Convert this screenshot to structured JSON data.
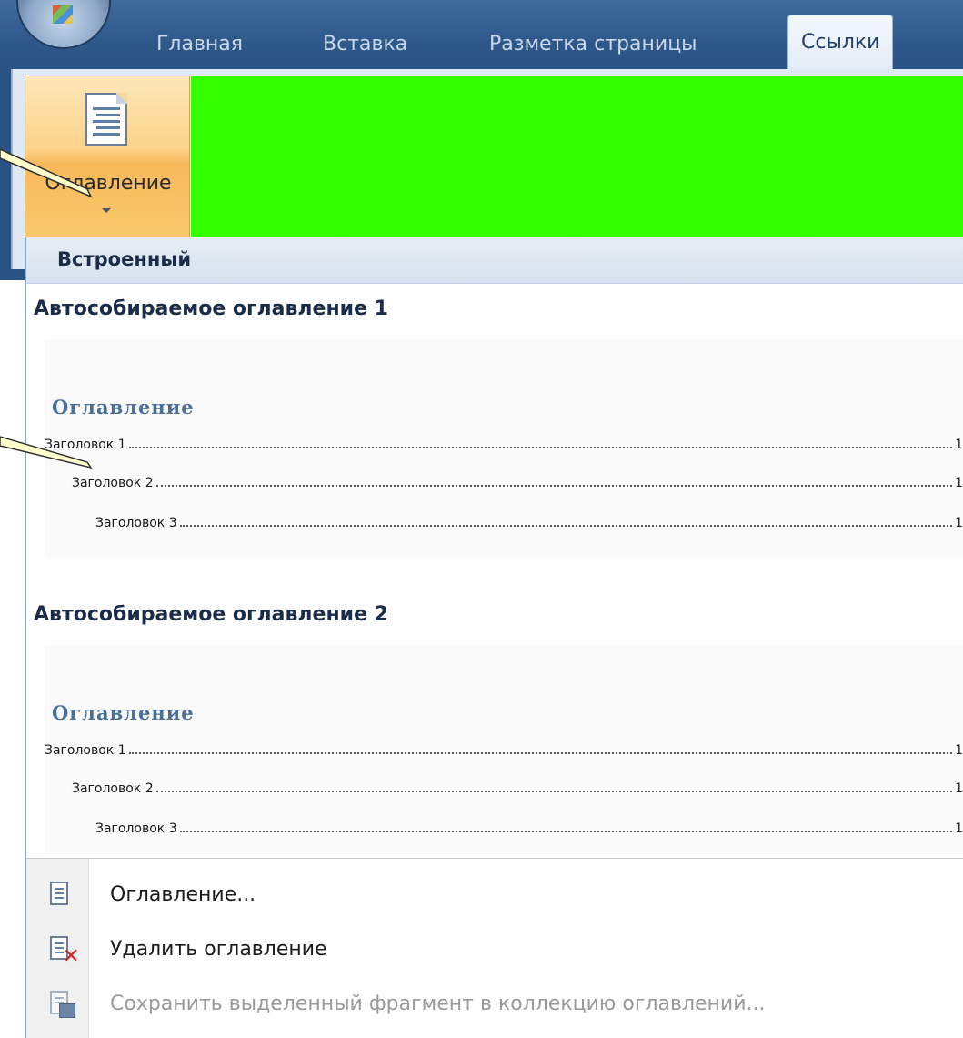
{
  "ribbon": {
    "tabs": [
      "Главная",
      "Вставка",
      "Разметка страницы",
      "Ссылки"
    ],
    "active_tab": "Ссылки",
    "toc_button_label": "Оглавление"
  },
  "dropdown": {
    "section_header": "Встроенный",
    "galleries": [
      {
        "title": "Автособираемое оглавление 1",
        "preview_title": "Оглавление",
        "entries": [
          {
            "text": "Заголовок 1",
            "page": "1"
          },
          {
            "text": "Заголовок 2",
            "page": "1"
          },
          {
            "text": "Заголовок 3",
            "page": "1"
          }
        ]
      },
      {
        "title": "Автособираемое оглавление 2",
        "preview_title": "Оглавление",
        "entries": [
          {
            "text": "Заголовок 1",
            "page": "1"
          },
          {
            "text": "Заголовок 2",
            "page": "1"
          },
          {
            "text": "Заголовок 3",
            "page": "1"
          }
        ]
      }
    ],
    "commands": [
      {
        "label": "Оглавление...",
        "icon": "toc-document-icon",
        "enabled": true
      },
      {
        "label": "Удалить оглавление",
        "icon": "remove-toc-icon",
        "enabled": true
      },
      {
        "label": "Сохранить выделенный фрагмент в коллекцию оглавлений...",
        "icon": "save-toc-icon",
        "enabled": false
      }
    ]
  },
  "colors": {
    "ribbon_blue": "#2a5283",
    "highlight_green": "#33ff00",
    "button_orange": "#f7b95a",
    "heading_navy": "#1b2c4a",
    "preview_title_blue": "#4a6f99",
    "callout_yellow": "#ffffcc"
  }
}
